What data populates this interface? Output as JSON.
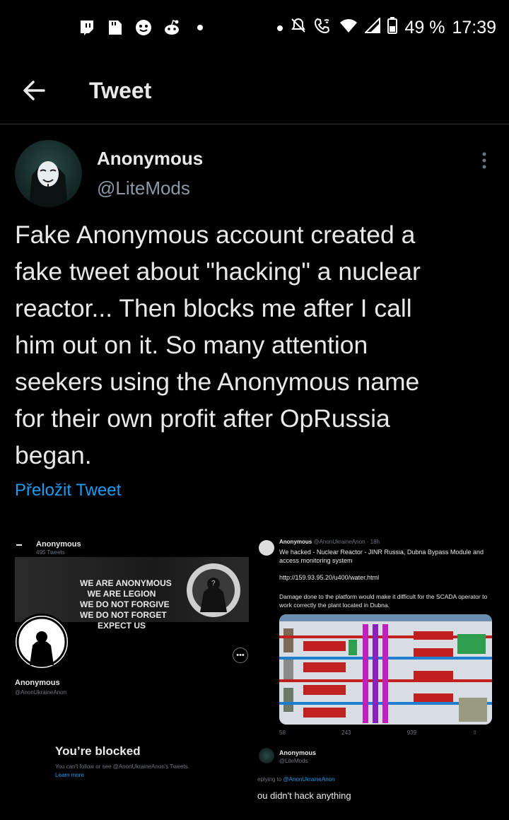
{
  "status_bar": {
    "battery": "49 %",
    "time": "17:39",
    "left_icons": [
      "twitch-icon",
      "sd-card-icon",
      "face-icon",
      "reddit-icon"
    ],
    "right_icons": [
      "mute-icon",
      "wifi-call-icon",
      "wifi-icon",
      "signal-icon",
      "battery-icon"
    ]
  },
  "header": {
    "title": "Tweet"
  },
  "tweet": {
    "author_name": "Anonymous",
    "author_handle": "@LiteMods",
    "text": "Fake Anonymous account created a\nfake tweet about \"hacking\" a nuclear\nreactor...  Then blocks me after I call\nhim out on it. So many attention\nseekers using the Anonymous name\nfor their own profit after OpRussia\nbegan.",
    "translate_label": "Přeložit Tweet"
  },
  "media_left": {
    "profile_name": "Anonymous",
    "profile_sub": "495 Tweets",
    "banner_lines": [
      "WE ARE ANONYMOUS",
      "WE ARE LEGION",
      "WE DO NOT FORGIVE",
      "WE DO NOT FORGET",
      "EXPECT US"
    ],
    "name": "Anonymous",
    "handle": "@AnonUkraineAnon",
    "blocked_title": "You’re blocked",
    "blocked_sub": "You can't follow or see @AnonUkraineAnon's Tweets.",
    "learn_more": "Learn more"
  },
  "media_right": {
    "tweet_name": "Anonymous",
    "tweet_meta": "@AnonUkraineAnon · 18h",
    "tweet_text": "We hacked - Nuclear Reactor - JINR Russia, Dubna Bypass Module and access monitoring system",
    "tweet_url": "http://159.93.95.20/u400/water.html",
    "tweet_text2": "Damage done to the platform would make it difficult for the SCADA operator to work correctly the plant located in Dubna.",
    "actions": [
      "58",
      "243",
      "939",
      ""
    ],
    "reply_name": "Anonymous",
    "reply_handle": "@LiteMods",
    "replying_prefix": "eplying to",
    "replying_to": "@AnonUkraineAnon",
    "reply_text": "ou didn't hack anything"
  },
  "colors": {
    "accent": "#1d9bf0",
    "background": "#000000",
    "text": "#e7e9ea",
    "muted": "#8b98a5"
  }
}
